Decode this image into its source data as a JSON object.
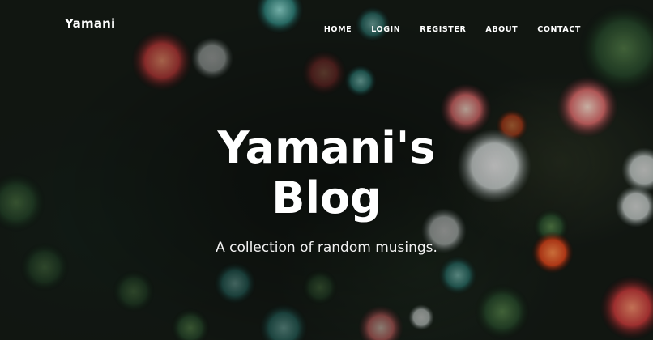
{
  "navbar": {
    "brand": "Yamani",
    "links": [
      "HOME",
      "LOGIN",
      "REGISTER",
      "ABOUT",
      "CONTACT"
    ]
  },
  "hero": {
    "title": "Yamani's Blog",
    "subtitle": "A collection of random musings."
  }
}
